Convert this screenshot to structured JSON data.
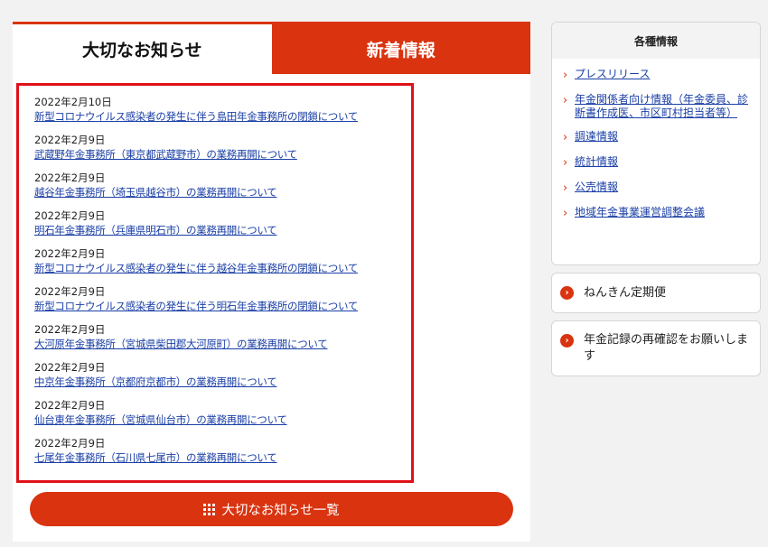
{
  "tabs": {
    "active_label": "大切なお知らせ",
    "inactive_label": "新着情報"
  },
  "news": [
    {
      "date": "2022年2月10日",
      "title": "新型コロナウイルス感染者の発生に伴う島田年金事務所の閉鎖について"
    },
    {
      "date": "2022年2月9日",
      "title": "武蔵野年金事務所（東京都武蔵野市）の業務再開について"
    },
    {
      "date": "2022年2月9日",
      "title": "越谷年金事務所（埼玉県越谷市）の業務再開について"
    },
    {
      "date": "2022年2月9日",
      "title": "明石年金事務所（兵庫県明石市）の業務再開について"
    },
    {
      "date": "2022年2月9日",
      "title": "新型コロナウイルス感染者の発生に伴う越谷年金事務所の閉鎖について"
    },
    {
      "date": "2022年2月9日",
      "title": "新型コロナウイルス感染者の発生に伴う明石年金事務所の閉鎖について"
    },
    {
      "date": "2022年2月9日",
      "title": "大河原年金事務所（宮城県柴田郡大河原町）の業務再開について"
    },
    {
      "date": "2022年2月9日",
      "title": "中京年金事務所（京都府京都市）の業務再開について"
    },
    {
      "date": "2022年2月9日",
      "title": "仙台東年金事務所（宮城県仙台市）の業務再開について"
    },
    {
      "date": "2022年2月9日",
      "title": "七尾年金事務所（石川県七尾市）の業務再開について"
    }
  ],
  "list_button": {
    "label": "大切なお知らせ一覧",
    "icon": "grid-icon"
  },
  "sidebar": {
    "info_title": "各種情報",
    "links": [
      "プレスリリース",
      "年金関係者向け情報（年金委員、診断書作成医、市区町村担当者等）",
      "調達情報",
      "統計情報",
      "公売情報",
      "地域年金事業運営調整会議"
    ],
    "card1": "ねんきん定期便",
    "card2": "年金記録の再確認をお願いします"
  },
  "colors": {
    "accent": "#d9330f",
    "highlight_border": "#e0111a",
    "link": "#1a3fa6"
  }
}
